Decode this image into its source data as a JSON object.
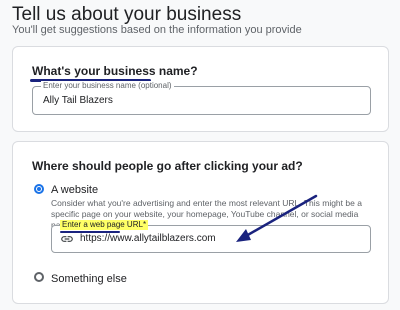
{
  "header": {
    "title": "Tell us about your business",
    "subtitle": "You'll get suggestions based on the information you provide"
  },
  "business_name": {
    "question": "What's your business name?",
    "field_label": "Enter your business name (optional)",
    "value": "Ally Tail Blazers"
  },
  "destination": {
    "question": "Where should people go after clicking your ad?",
    "options": [
      {
        "label": "A website",
        "selected": true,
        "help": "Consider what you're advertising and enter the most relevant URL. This might be a specific page on your website, your homepage, YouTube channel, or social media page."
      },
      {
        "label": "Something else",
        "selected": false
      }
    ],
    "url_field_label": "Enter a web page URL*",
    "url_value": "https://www.allytailblazers.com",
    "url_icon": "link-icon"
  },
  "colors": {
    "accent": "#1a73e8",
    "annotation": "#1a237e",
    "highlight": "#ffff66"
  }
}
